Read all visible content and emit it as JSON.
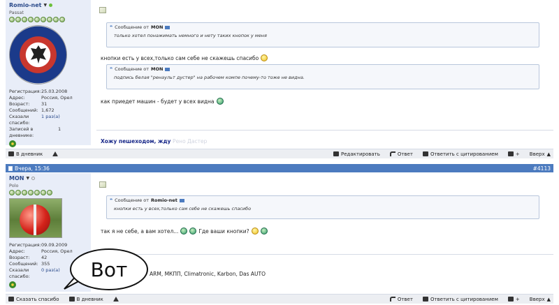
{
  "post1": {
    "user": {
      "name": "Romio-net",
      "title": "Passat",
      "stats": [
        {
          "label": "Регистрация:",
          "value": "25.03.2008",
          "link": false
        },
        {
          "label": "Адрес:",
          "value": "Россия, Орел",
          "link": false
        },
        {
          "label": "Возраст:",
          "value": "31",
          "link": false
        },
        {
          "label": "Сообщений:",
          "value": "1,672",
          "link": false
        },
        {
          "label": "Сказали спасибо:",
          "value": "1 раз(а)",
          "link": true
        },
        {
          "label": "Записей в дневнике:",
          "value": "1",
          "link": false
        }
      ]
    },
    "quote1": {
      "prefix": "Сообщение от",
      "author": "MON",
      "text": "только хотел понажимать немного и нету таких кнопок у меня"
    },
    "text1": "кнопки есть у всех,только сам себе не скажешь спасибо",
    "quote2": {
      "prefix": "Сообщение от",
      "author": "MON",
      "text": "подпись белая \"ренаульт дустер\" на рабочем компе почему-то тоже не видна."
    },
    "text2": "как приедет машин - будет у всех видна",
    "signature": "Хожу пешеходом, жду",
    "signature_faded": "Рено Дастер",
    "toolbar": {
      "diary": "В дневник",
      "edit": "Редактировать",
      "reply": "Ответ",
      "quote": "Ответить с цитированием",
      "up": "Вверх"
    }
  },
  "post2": {
    "header": {
      "date": "Вчера, 15:36",
      "number": "#4113"
    },
    "user": {
      "name": "MON",
      "title": "Polo",
      "stats": [
        {
          "label": "Регистрация:",
          "value": "09.09.2009",
          "link": false
        },
        {
          "label": "Адрес:",
          "value": "Россия, Орел",
          "link": false
        },
        {
          "label": "Возраст:",
          "value": "42",
          "link": false
        },
        {
          "label": "Сообщений:",
          "value": "355",
          "link": false
        },
        {
          "label": "Сказали спасибо:",
          "value": "0 раз(а)",
          "link": true
        }
      ]
    },
    "quote1": {
      "prefix": "Сообщение от",
      "author": "Romio-net",
      "text": "кнопки есть у всех,только сам себе не скажешь спасибо"
    },
    "text1a": "так я не себе, а вам хотел...",
    "text1b": "Где ваши кнопки?",
    "signature": "ARM, МКПП, Climatronic, Karbon, Das AUTO",
    "toolbar": {
      "thanks": "Сказать спасибо",
      "diary": "В дневник",
      "reply": "Ответ",
      "quote": "Ответить с цитированием",
      "up": "Вверх"
    }
  },
  "bubble": {
    "text": "Вот"
  },
  "colors": {
    "header": "#4c7bbf",
    "userpanel": "#e8edf8",
    "toolbar": "#eceef2",
    "link": "#2a4a8a"
  }
}
